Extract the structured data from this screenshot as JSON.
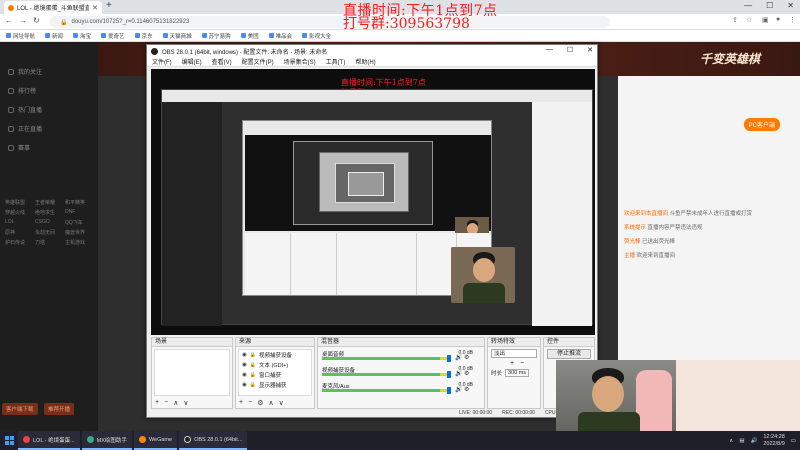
{
  "browser": {
    "tab_title": "LOL - 绝境蛋蛋_斗鱼联盟直播...",
    "url": "douyu.com/10725?_r=0.1146075131822923",
    "bookmarks": [
      "网址导航",
      "新闻",
      "淘宝",
      "爱奇艺",
      "京东",
      "天猫商城",
      "苏宁易购",
      "美团",
      "唯品会",
      "影视大全"
    ]
  },
  "overlay": {
    "time_text": "直播时间:下午1点到7点",
    "qq_text": "打号群:309563798"
  },
  "douyu": {
    "sidebar_items": [
      "我的关注",
      "排行榜",
      "热门直播",
      "正在直播",
      "赛事"
    ],
    "category_grid": [
      "英雄联盟",
      "王者荣耀",
      "和平精英",
      "穿越火线",
      "绝地求生",
      "DNF",
      "LOL",
      "CSGO",
      "QQ飞车",
      "原神",
      "永劫无间",
      "魔兽世界",
      "炉石传说",
      "刀塔",
      "主机游戏"
    ],
    "bottom_buttons": [
      "客户端下载",
      "推荐开播"
    ],
    "banner_title": "千变英雄棋",
    "pc_button": "PC客户端",
    "chat_lines": [
      {
        "user": "欢迎来到本直播间",
        "text": "斗鱼严禁未成年人进行直播或打赏"
      },
      {
        "user": "系统提示",
        "text": "直播内容严禁违法违规"
      },
      {
        "user": "荧光棒",
        "text": "已送出荧光棒"
      },
      {
        "user": "主播",
        "text": "欢迎来到直播间"
      }
    ]
  },
  "obs": {
    "title": "OBS 28.0.1 (64bit, windows) - 配置文件: 未命名 - 场景: 未命名",
    "menu": [
      "文件(F)",
      "编辑(E)",
      "查看(V)",
      "配置文件(P)",
      "场景集合(S)",
      "工具(T)",
      "帮助(H)"
    ],
    "panels": {
      "scenes": "场景",
      "sources": "来源",
      "mixer": "混音器",
      "transitions": "转场特效",
      "controls": "控件"
    },
    "sources": [
      "视频捕获设备",
      "文本 (GDI+)",
      "窗口捕获",
      "显示器捕获"
    ],
    "mixer": [
      {
        "name": "桌面音频",
        "db": "0.0 dB"
      },
      {
        "name": "视频捕获设备",
        "db": "0.0 dB"
      },
      {
        "name": "麦克风/Aux",
        "db": "0.0 dB"
      }
    ],
    "transition": "淡出",
    "duration_label": "时长",
    "duration_value": "300 ms",
    "control_button": "停止推流",
    "status": [
      "LIVE: 00:00:00",
      "REC: 00:00:00",
      "CPU: 1.4%, 30.00 fps"
    ]
  },
  "taskbar": {
    "tasks": [
      "LOL - 绝境蛋蛋...",
      "MX绘图助手",
      "WeGame",
      "OBS 28.0.1 (64bit..."
    ],
    "time": "12:24:28",
    "date": "2022/8/9"
  }
}
